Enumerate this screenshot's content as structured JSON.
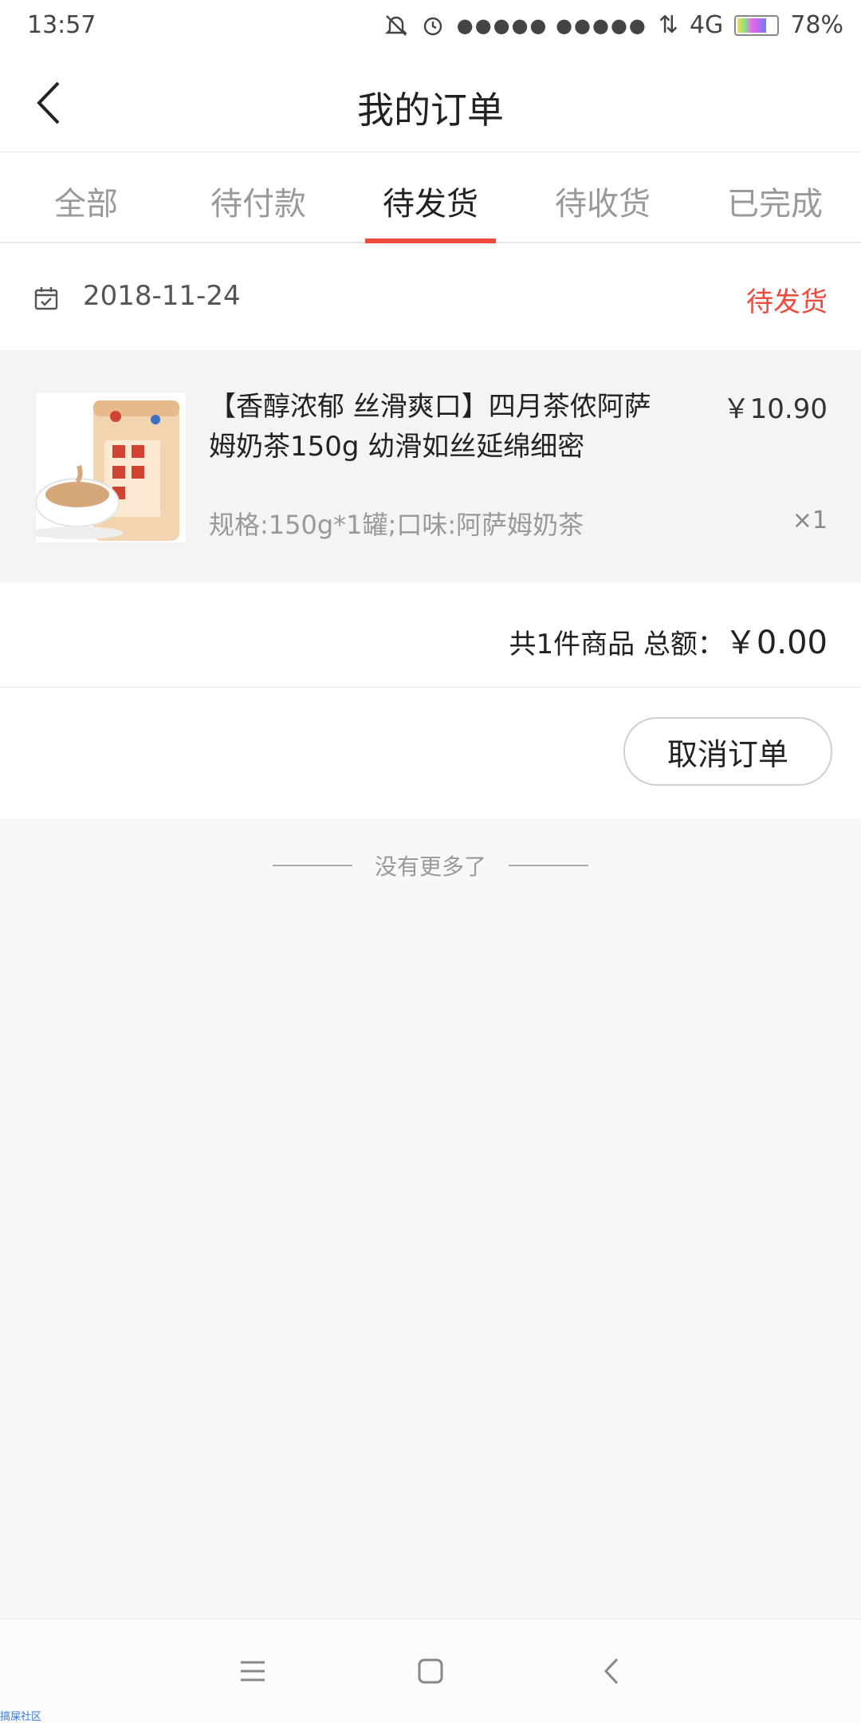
{
  "status_bar": {
    "time": "13:57",
    "signal": "●●●●● ●●●●●",
    "network": "4G",
    "battery": "78%"
  },
  "header": {
    "title": "我的订单",
    "back_icon": "chevron-left-icon"
  },
  "tabs": [
    {
      "label": "全部",
      "active": false
    },
    {
      "label": "待付款",
      "active": false
    },
    {
      "label": "待发货",
      "active": true
    },
    {
      "label": "待收货",
      "active": false
    },
    {
      "label": "已完成",
      "active": false
    }
  ],
  "order": {
    "date": "2018-11-24",
    "status": "待发货",
    "product": {
      "title": "【香醇浓郁 丝滑爽口】四月茶侬阿萨姆奶茶150g 幼滑如丝延绵细密",
      "price": "￥10.90",
      "spec": "规格:150g*1罐;口味:阿萨姆奶茶",
      "qty": "×1"
    },
    "summary": {
      "count_text": "共1件商品 总额：",
      "total": "￥0.00"
    },
    "cancel_label": "取消订单"
  },
  "footer": {
    "no_more": "没有更多了"
  },
  "watermark": "搞屎社区",
  "colors": {
    "accent": "#f04a3c"
  }
}
